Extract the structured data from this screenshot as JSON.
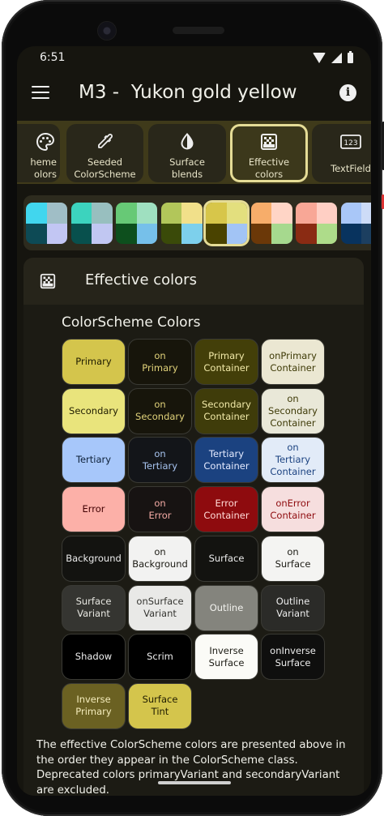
{
  "status": {
    "time": "6:51"
  },
  "appbar": {
    "title": "M3 -  Yukon gold yellow"
  },
  "tabs": [
    {
      "label": "heme\nolors",
      "icon": "palette-icon"
    },
    {
      "label": "Seeded\nColorScheme",
      "icon": "eyedropper-icon"
    },
    {
      "label": "Surface\nblends",
      "icon": "contrast-drop-icon"
    },
    {
      "label": "Effective\ncolors",
      "icon": "gradient-grid-icon",
      "selected": true
    },
    {
      "label": "TextField",
      "icon": "textfield-123-icon"
    }
  ],
  "schemes": [
    {
      "colors": [
        "#41d6ee",
        "#a0bec6",
        "#0d4a55",
        "#c2c6f3"
      ]
    },
    {
      "colors": [
        "#3cd3be",
        "#98bfbf",
        "#08504d",
        "#c1c7f2"
      ]
    },
    {
      "colors": [
        "#67c976",
        "#9fe0c0",
        "#0d4f1d",
        "#76c0ea"
      ]
    },
    {
      "colors": [
        "#b2c65a",
        "#f1e08a",
        "#3a4a09",
        "#7dd0ec"
      ]
    },
    {
      "colors": [
        "#d7c64a",
        "#e3df7e",
        "#4a4300",
        "#a2c4f5"
      ],
      "selected": true
    },
    {
      "colors": [
        "#f7ad6a",
        "#ffd5c6",
        "#6b3808",
        "#a6d98e"
      ]
    },
    {
      "colors": [
        "#f8a796",
        "#ffcfc4",
        "#8a2b13",
        "#aedc8a"
      ]
    },
    {
      "colors": [
        "#a9c7f8",
        "#cddcf7",
        "#08335e",
        "#1c3f60"
      ]
    }
  ],
  "card": {
    "title": "Effective colors",
    "section_title": "ColorScheme Colors"
  },
  "color_boxes": [
    {
      "label": "Primary",
      "bg": "#d4c54c",
      "fg": "#1f1c00"
    },
    {
      "label": "on\nPrimary",
      "bg": "#17150b",
      "fg": "#e1d27a"
    },
    {
      "label": "Primary\nContainer",
      "bg": "#433f09",
      "fg": "#f1e9a8"
    },
    {
      "label": "onPrimary\nContainer",
      "bg": "#ebe7d2",
      "fg": "#3e3a07"
    },
    {
      "label": "Secondary",
      "bg": "#e9e47c",
      "fg": "#1f1c00"
    },
    {
      "label": "on\nSecondary",
      "bg": "#17150b",
      "fg": "#e1d27a"
    },
    {
      "label": "Secondary\nContainer",
      "bg": "#3f3c0a",
      "fg": "#f1e9a8"
    },
    {
      "label": "on\nSecondary\nContainer",
      "bg": "#e9e8d8",
      "fg": "#3e3a07"
    },
    {
      "label": "Tertiary",
      "bg": "#a7c7fa",
      "fg": "#0d2038"
    },
    {
      "label": "on\nTertiary",
      "bg": "#131519",
      "fg": "#a7c4f0"
    },
    {
      "label": "Tertiary\nContainer",
      "bg": "#1b4280",
      "fg": "#e5ebff"
    },
    {
      "label": "on\nTertiary\nContainer",
      "bg": "#e2ebf8",
      "fg": "#1b4280"
    },
    {
      "label": "Error",
      "bg": "#fcb0a8",
      "fg": "#410002"
    },
    {
      "label": "on\nError",
      "bg": "#171312",
      "fg": "#f3aaa4"
    },
    {
      "label": "Error\nContainer",
      "bg": "#8e0b0e",
      "fg": "#ffdad6"
    },
    {
      "label": "onError\nContainer",
      "bg": "#f6dede",
      "fg": "#8e0b0e"
    },
    {
      "label": "Background",
      "bg": "#131310",
      "fg": "#ececec"
    },
    {
      "label": "on\nBackground",
      "bg": "#f2f2f1",
      "fg": "#1c1b14"
    },
    {
      "label": "Surface",
      "bg": "#131310",
      "fg": "#ececec"
    },
    {
      "label": "on\nSurface",
      "bg": "#f4f4f2",
      "fg": "#1c1b14"
    },
    {
      "label": "Surface\nVariant",
      "bg": "#353531",
      "fg": "#e8e8e2"
    },
    {
      "label": "onSurface\nVariant",
      "bg": "#e9e9e7",
      "fg": "#353531"
    },
    {
      "label": "Outline",
      "bg": "#84847d",
      "fg": "#f2f2ee"
    },
    {
      "label": "Outline\nVariant",
      "bg": "#2b2b28",
      "fg": "#ececec"
    },
    {
      "label": "Shadow",
      "bg": "#000000",
      "fg": "#f0f0f0"
    },
    {
      "label": "Scrim",
      "bg": "#000000",
      "fg": "#f0f0f0"
    },
    {
      "label": "Inverse\nSurface",
      "bg": "#fbfbf7",
      "fg": "#1c1b14"
    },
    {
      "label": "onInverse\nSurface",
      "bg": "#0f0f0e",
      "fg": "#ececec"
    },
    {
      "label": "Inverse\nPrimary",
      "bg": "#6b6122",
      "fg": "#f4ecbb"
    },
    {
      "label": "Surface\nTint",
      "bg": "#d4c54c",
      "fg": "#1f1c00"
    }
  ],
  "footer": {
    "text": "The effective ColorScheme colors are presented above in the order they appear in the ColorScheme class. Deprecated colors primaryVariant and secondaryVariant are excluded."
  }
}
